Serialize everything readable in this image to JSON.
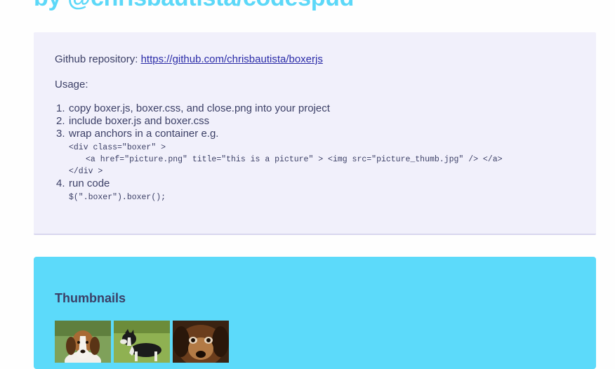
{
  "header": {
    "title": "by @chrisbautista/codespud"
  },
  "usage_panel": {
    "repo_label": "Github repository:",
    "repo_link_text": "https://github.com/chrisbautista/boxerjs",
    "usage_heading": "Usage:",
    "steps": [
      {
        "number": "1.",
        "text": "copy boxer.js, boxer.css, and close.png into your project"
      },
      {
        "number": "2.",
        "text": "include boxer.js and boxer.css"
      },
      {
        "number": "3.",
        "text": "wrap anchors in a container e.g.",
        "code_lines": [
          "<div class=\"boxer\" >",
          "<a href=\"picture.png\" title=\"this is a picture\" > <img src=\"picture_thumb.jpg\" /> </a>",
          "</div >"
        ]
      },
      {
        "number": "4.",
        "text": "run code",
        "code_lines": [
          "$(\".boxer\").boxer();"
        ]
      }
    ]
  },
  "thumbnails": {
    "heading": "Thumbnails",
    "items": [
      {
        "name": "beagle-puppy-thumbnail"
      },
      {
        "name": "border-collie-thumbnail"
      },
      {
        "name": "brown-dog-closeup-thumbnail"
      }
    ]
  }
}
